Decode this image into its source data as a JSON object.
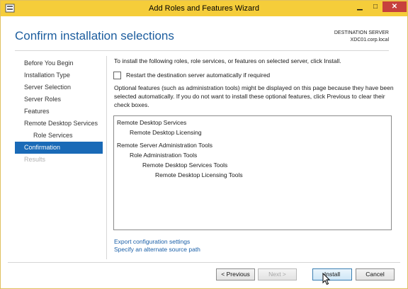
{
  "window": {
    "title": "Add Roles and Features Wizard",
    "accent": "#f5cd3a",
    "controls": {
      "minimize": "▁",
      "maximize": "□",
      "close": "✕"
    }
  },
  "header": {
    "title": "Confirm installation selections",
    "destination_label": "DESTINATION SERVER",
    "destination_value": "XDC01.corp.local"
  },
  "nav": {
    "items": [
      {
        "label": "Before You Begin",
        "state": "normal"
      },
      {
        "label": "Installation Type",
        "state": "normal"
      },
      {
        "label": "Server Selection",
        "state": "normal"
      },
      {
        "label": "Server Roles",
        "state": "normal"
      },
      {
        "label": "Features",
        "state": "normal"
      },
      {
        "label": "Remote Desktop Services",
        "state": "normal"
      },
      {
        "label": "Role Services",
        "state": "sub"
      },
      {
        "label": "Confirmation",
        "state": "active"
      },
      {
        "label": "Results",
        "state": "disabled"
      }
    ]
  },
  "main": {
    "intro": "To install the following roles, role services, or features on selected server, click Install.",
    "restart_checkbox": {
      "label": "Restart the destination server automatically if required",
      "checked": false
    },
    "note": "Optional features (such as administration tools) might be displayed on this page because they have been selected automatically. If you do not want to install these optional features, click Previous to clear their check boxes.",
    "selections": [
      {
        "label": "Remote Desktop Services",
        "level": 0
      },
      {
        "label": "Remote Desktop Licensing",
        "level": 1
      },
      {
        "label": "Remote Server Administration Tools",
        "level": 0
      },
      {
        "label": "Role Administration Tools",
        "level": 1
      },
      {
        "label": "Remote Desktop Services Tools",
        "level": 2
      },
      {
        "label": "Remote Desktop Licensing Tools",
        "level": 3
      }
    ],
    "links": {
      "export": "Export configuration settings",
      "alternate_source": "Specify an alternate source path"
    }
  },
  "footer": {
    "previous": "< Previous",
    "next": "Next >",
    "install": "Install",
    "cancel": "Cancel"
  }
}
